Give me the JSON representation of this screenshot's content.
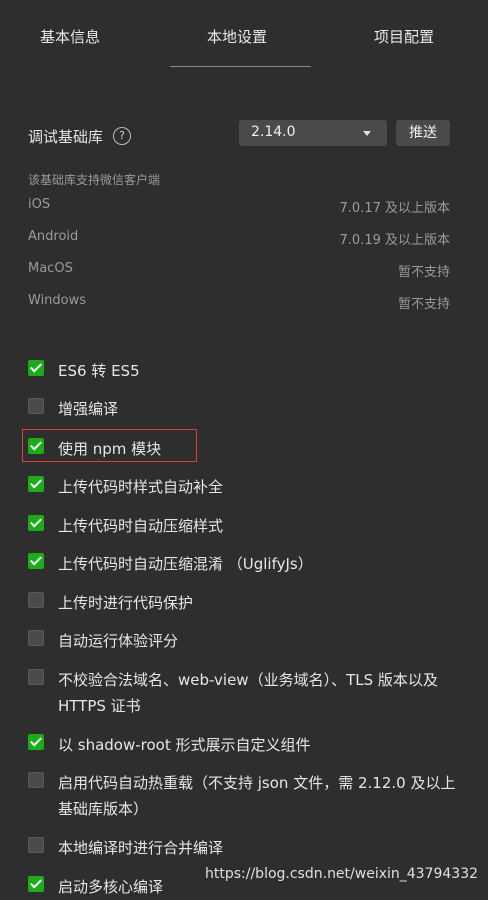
{
  "tabs": [
    "基本信息",
    "本地设置",
    "项目配置"
  ],
  "base_lib": {
    "label": "调试基础库",
    "help_icon": "question-circle-icon",
    "version": "2.14.0",
    "push_label": "推送"
  },
  "support": {
    "note": "该基础库支持微信客户端",
    "platforms": [
      {
        "name": "iOS",
        "requirement": "7.0.17 及以上版本"
      },
      {
        "name": "Android",
        "requirement": "7.0.19 及以上版本"
      },
      {
        "name": "MacOS",
        "requirement": "暂不支持"
      },
      {
        "name": "Windows",
        "requirement": "暂不支持"
      }
    ]
  },
  "options": [
    {
      "label": "ES6 转 ES5",
      "checked": true
    },
    {
      "label": "增强编译",
      "checked": false
    },
    {
      "label": "使用 npm 模块",
      "checked": true
    },
    {
      "label": "上传代码时样式自动补全",
      "checked": true
    },
    {
      "label": "上传代码时自动压缩样式",
      "checked": true
    },
    {
      "label": "上传代码时自动压缩混淆 （UglifyJs）",
      "checked": true
    },
    {
      "label": "上传时进行代码保护",
      "checked": false
    },
    {
      "label": "自动运行体验评分",
      "checked": false
    },
    {
      "label": "不校验合法域名、web-view（业务域名）、TLS 版本以及 HTTPS 证书",
      "checked": false
    },
    {
      "label": "以 shadow-root 形式展示自定义组件",
      "checked": true
    },
    {
      "label": "启用代码自动热重载（不支持 json 文件，需 2.12.0 及以上基础库版本）",
      "checked": false
    },
    {
      "label": "本地编译时进行合并编译",
      "checked": false
    },
    {
      "label": "启动多核心编译",
      "checked": true
    }
  ],
  "colors": {
    "checked": "#1aad19",
    "highlight": "#d9413d",
    "background": "#2e2e2e"
  },
  "watermark": "https://blog.csdn.net/weixin_43794332"
}
